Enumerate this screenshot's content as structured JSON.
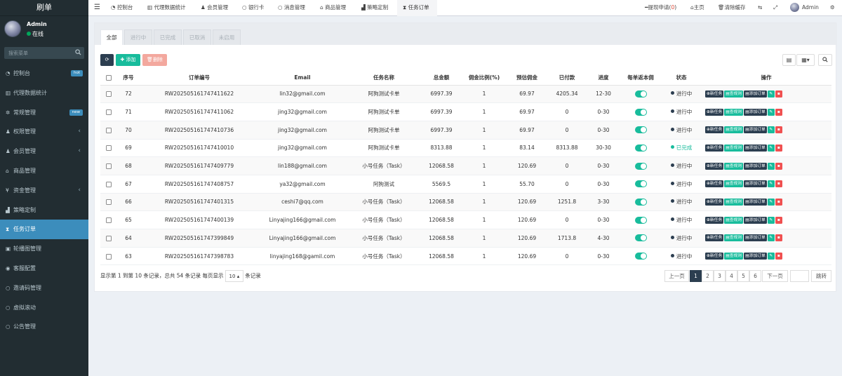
{
  "sidebar": {
    "logo": "刷单",
    "user_name": "Admin",
    "user_status": "在线",
    "search_placeholder": "搜索菜单",
    "items": [
      {
        "label": "控制台",
        "icon": "dashboard-icon",
        "badge": "hot"
      },
      {
        "label": "代理数据统计",
        "icon": "bar-chart-icon"
      },
      {
        "label": "常规管理",
        "icon": "cogs-icon",
        "badge": "new"
      },
      {
        "label": "权限管理",
        "icon": "group-icon",
        "has_children": true
      },
      {
        "label": "会员管理",
        "icon": "user-icon",
        "has_children": true
      },
      {
        "label": "商品管理",
        "icon": "shop-icon"
      },
      {
        "label": "资金管理",
        "icon": "yen-icon",
        "has_children": true
      },
      {
        "label": "策略定制",
        "icon": "area-chart-icon"
      },
      {
        "label": "任务订单",
        "icon": "hourglass-icon",
        "active": true
      },
      {
        "label": "轮播图管理",
        "icon": "image-icon"
      },
      {
        "label": "客服配置",
        "icon": "support-icon"
      },
      {
        "label": "邀请码管理",
        "icon": "circle-icon"
      },
      {
        "label": "虚拟滚动",
        "icon": "circle-icon"
      },
      {
        "label": "公告管理",
        "icon": "circle-icon"
      }
    ]
  },
  "topbar": {
    "tabs": [
      "控制台",
      "代理数据统计",
      "会员管理",
      "银行卡",
      "消息管理",
      "商品管理",
      "策略定制",
      "任务订单"
    ],
    "active_tab": "任务订单",
    "withdraw_label": "提现申请",
    "withdraw_count": "0",
    "home_label": "主页",
    "clear_cache_label": "清除缓存",
    "admin_label": "Admin"
  },
  "filter_tabs": [
    "全部",
    "进行中",
    "已完成",
    "已取消",
    "未启用"
  ],
  "toolbar": {
    "add_label": "添加",
    "delete_label": "删除"
  },
  "table": {
    "headers": [
      "序号",
      "订单编号",
      "Email",
      "任务名称",
      "总金额",
      "佣金比例(%)",
      "预估佣金",
      "已付款",
      "进度",
      "每单返本佣",
      "状态",
      "操作"
    ],
    "actions": [
      "新任务",
      "查规则",
      "添加订单"
    ],
    "rows": [
      {
        "id": "72",
        "order_no": "RW202505161747411622",
        "email": "lin32@gmail.com",
        "task": "阿狗测试卡单",
        "total": "6997.39",
        "rate": "1",
        "est": "69.97",
        "paid": "4205.34",
        "progress": "12-30",
        "status": "进行中",
        "done": false
      },
      {
        "id": "71",
        "order_no": "RW202505161747411062",
        "email": "jing32@gmail.com",
        "task": "阿狗测试卡单",
        "total": "6997.39",
        "rate": "1",
        "est": "69.97",
        "paid": "0",
        "progress": "0-30",
        "status": "进行中",
        "done": false
      },
      {
        "id": "70",
        "order_no": "RW202505161747410736",
        "email": "jing32@gmail.com",
        "task": "阿狗测试卡单",
        "total": "6997.39",
        "rate": "1",
        "est": "69.97",
        "paid": "0",
        "progress": "0-30",
        "status": "进行中",
        "done": false
      },
      {
        "id": "69",
        "order_no": "RW202505161747410010",
        "email": "jing32@gmail.com",
        "task": "阿狗测试卡单",
        "total": "8313.88",
        "rate": "1",
        "est": "83.14",
        "paid": "8313.88",
        "progress": "30-30",
        "status": "已完成",
        "done": true
      },
      {
        "id": "68",
        "order_no": "RW202505161747409779",
        "email": "lin188@gmail.com",
        "task": "小号任务（Task）",
        "total": "12068.58",
        "rate": "1",
        "est": "120.69",
        "paid": "0",
        "progress": "0-30",
        "status": "进行中",
        "done": false
      },
      {
        "id": "67",
        "order_no": "RW202505161747408757",
        "email": "ya32@gmail.com",
        "task": "阿狗测试",
        "total": "5569.5",
        "rate": "1",
        "est": "55.70",
        "paid": "0",
        "progress": "0-30",
        "status": "进行中",
        "done": false
      },
      {
        "id": "66",
        "order_no": "RW202505161747401315",
        "email": "ceshi7@qq.com",
        "task": "小号任务（Task）",
        "total": "12068.58",
        "rate": "1",
        "est": "120.69",
        "paid": "1251.8",
        "progress": "3-30",
        "status": "进行中",
        "done": false
      },
      {
        "id": "65",
        "order_no": "RW202505161747400139",
        "email": "Linyajing166@gmail.com",
        "task": "小号任务（Task）",
        "total": "12068.58",
        "rate": "1",
        "est": "120.69",
        "paid": "0",
        "progress": "0-30",
        "status": "进行中",
        "done": false
      },
      {
        "id": "64",
        "order_no": "RW202505161747399849",
        "email": "Linyajing166@gmail.com",
        "task": "小号任务（Task）",
        "total": "12068.58",
        "rate": "1",
        "est": "120.69",
        "paid": "1713.8",
        "progress": "4-30",
        "status": "进行中",
        "done": false
      },
      {
        "id": "63",
        "order_no": "RW202505161747398783",
        "email": "linyajing168@gamil.com",
        "task": "小号任务（Task）",
        "total": "12068.58",
        "rate": "1",
        "est": "120.69",
        "paid": "0",
        "progress": "0-30",
        "status": "进行中",
        "done": false
      }
    ]
  },
  "pagination": {
    "info_prefix": "显示第 1 到第 10 条记录，总共 54 条记录 每页显示",
    "page_size": "10",
    "info_suffix": "条记录",
    "prev_label": "上一页",
    "next_label": "下一页",
    "pages": [
      "1",
      "2",
      "3",
      "4",
      "5",
      "6"
    ],
    "active_page": "1",
    "jump_label": "跳转"
  },
  "colors": {
    "sidebar_bg": "#222d32",
    "active_blue": "#3c8dbc",
    "success": "#18bc9c",
    "danger": "#f05050",
    "dark": "#2c3e50"
  }
}
